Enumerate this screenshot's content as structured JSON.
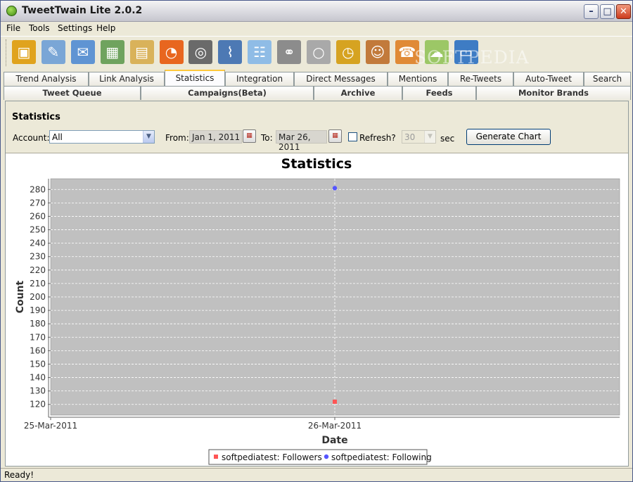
{
  "window": {
    "title": "TweetTwain Lite 2.0.2",
    "minimize": "–",
    "maximize": "□",
    "close": "✕"
  },
  "menu": [
    "File",
    "Tools",
    "Settings",
    "Help"
  ],
  "toolbar": [
    {
      "icon": "package-icon",
      "glyph": "▣",
      "color": "#e0a31e"
    },
    {
      "icon": "compose-tweet-icon",
      "glyph": "✎",
      "color": "#7aa6d6"
    },
    {
      "icon": "envelope-icon",
      "glyph": "✉",
      "color": "#5f94d3"
    },
    {
      "icon": "calendar-add-icon",
      "glyph": "▦",
      "color": "#6fa35e"
    },
    {
      "icon": "folder-database-icon",
      "glyph": "▤",
      "color": "#d9b25a"
    },
    {
      "icon": "rss-feed-icon",
      "glyph": "◔",
      "color": "#e8661f"
    },
    {
      "icon": "binoculars-icon",
      "glyph": "◎",
      "color": "#6a6a6a"
    },
    {
      "icon": "satellite-dish-icon",
      "glyph": "⌇",
      "color": "#4d79b4"
    },
    {
      "icon": "chat-bubbles-icon",
      "glyph": "☷",
      "color": "#8fbce6"
    },
    {
      "icon": "link-icon",
      "glyph": "⚭",
      "color": "#8c8c8c"
    },
    {
      "icon": "disabled-clock-icon",
      "glyph": "○",
      "color": "#a9a9a9"
    },
    {
      "icon": "alarm-clock-icon",
      "glyph": "◷",
      "color": "#d6a321"
    },
    {
      "icon": "users-edit-icon",
      "glyph": "☺",
      "color": "#c27a3b"
    },
    {
      "icon": "support-agent-icon",
      "glyph": "☎",
      "color": "#e08a36"
    },
    {
      "icon": "cloud-download-icon",
      "glyph": "☁",
      "color": "#9cc766"
    },
    {
      "icon": "monitor-export-icon",
      "glyph": "▭",
      "color": "#3e7cc4"
    }
  ],
  "watermark": "SOFTPEDIA",
  "tabs_row1": [
    "Trend Analysis",
    "Link Analysis",
    "Statistics",
    "Integration",
    "Direct Messages",
    "Mentions",
    "Re-Tweets",
    "Auto-Tweet",
    "Search"
  ],
  "tabs_row2": [
    "Tweet Queue",
    "Campaigns(Beta)",
    "Archive",
    "Feeds",
    "Monitor Brands"
  ],
  "active_tab": "Statistics",
  "controls": {
    "heading": "Statistics",
    "account_label": "Account:",
    "account_value": "All",
    "from_label": "From:",
    "from_value": "Jan 1, 2011",
    "to_label": "To:",
    "to_value": "Mar 26, 2011",
    "refresh_label": "Refresh?",
    "refresh_checked": false,
    "interval_value": "30",
    "interval_unit": "sec",
    "generate_label": "Generate Chart"
  },
  "chart_data": {
    "type": "scatter",
    "title": "Statistics",
    "xlabel": "Date",
    "ylabel": "Count",
    "x_ticks": [
      "25-Mar-2011",
      "26-Mar-2011"
    ],
    "y_ticks": [
      120,
      130,
      140,
      150,
      160,
      170,
      180,
      190,
      200,
      210,
      220,
      230,
      240,
      250,
      260,
      270,
      280
    ],
    "ylim": [
      112,
      288
    ],
    "xlim": [
      "25-Mar-2011",
      "27-Mar-2011"
    ],
    "plot_background": "#c0c0c0",
    "grid": true,
    "legend_position": "bottom",
    "series": [
      {
        "name": "softpediatest: Followers",
        "marker": "square",
        "color": "#ff5555",
        "points": [
          {
            "x": "26-Mar-2011",
            "y": 122
          }
        ]
      },
      {
        "name": "softpediatest: Following",
        "marker": "circle",
        "color": "#5555ff",
        "points": [
          {
            "x": "26-Mar-2011",
            "y": 281
          }
        ]
      }
    ]
  },
  "status": "Ready!"
}
